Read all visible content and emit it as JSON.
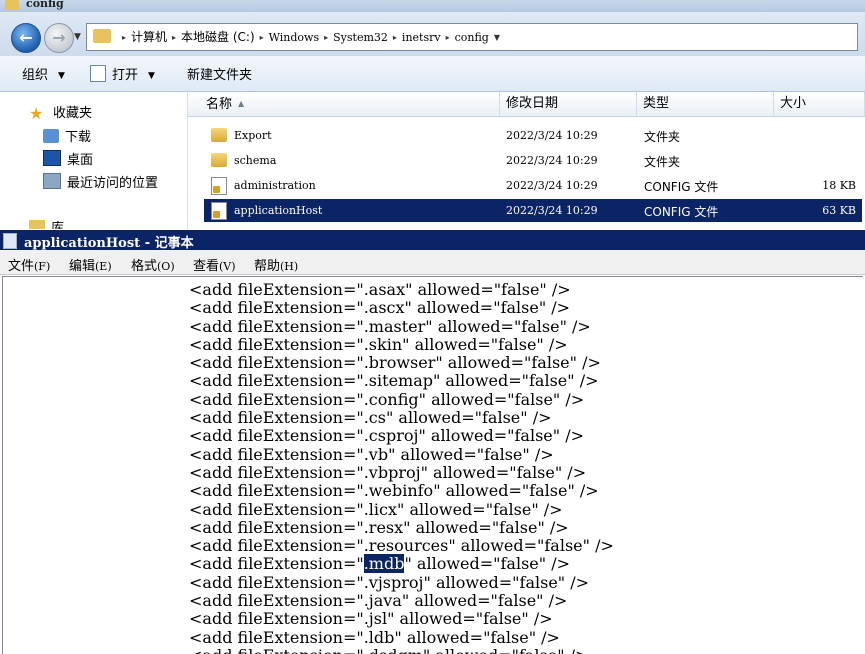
{
  "explorer": {
    "title": "config",
    "address": {
      "crumbs": [
        "计算机",
        "本地磁盘 (C:)",
        "Windows",
        "System32",
        "inetsrv",
        "config"
      ],
      "separator": "▸"
    },
    "toolbar": {
      "organize": "组织",
      "open": "打开",
      "new_folder": "新建文件夹"
    },
    "nav": {
      "favorites": "收藏夹",
      "downloads": "下载",
      "desktop": "桌面",
      "recent": "最近访问的位置",
      "libraries": "库"
    },
    "columns": {
      "name": "名称",
      "date": "修改日期",
      "type": "类型",
      "size": "大小"
    },
    "files": [
      {
        "name": "Export",
        "date": "2022/3/24 10:29",
        "type": "文件夹",
        "size": "",
        "icon": "folder-icon"
      },
      {
        "name": "schema",
        "date": "2022/3/24 10:29",
        "type": "文件夹",
        "size": "",
        "icon": "folder-icon"
      },
      {
        "name": "administration",
        "date": "2022/3/24 10:29",
        "type": "CONFIG 文件",
        "size": "18 KB",
        "icon": "config-file-icon"
      },
      {
        "name": "applicationHost",
        "date": "2022/3/24 10:29",
        "type": "CONFIG 文件",
        "size": "63 KB",
        "icon": "config-file-icon",
        "selected": true
      }
    ]
  },
  "notepad": {
    "title_file": "applicationHost",
    "title_app": " - 记事本",
    "menu": [
      {
        "label": "文件",
        "accel": "(F)"
      },
      {
        "label": "编辑",
        "accel": "(E)"
      },
      {
        "label": "格式",
        "accel": "(O)"
      },
      {
        "label": "查看",
        "accel": "(V)"
      },
      {
        "label": "帮助",
        "accel": "(H)"
      }
    ],
    "lines": [
      {
        "pre": "<add fileExtension=\"",
        "ext": ".asax",
        "post": "\" allowed=\"false\" />"
      },
      {
        "pre": "<add fileExtension=\"",
        "ext": ".ascx",
        "post": "\" allowed=\"false\" />"
      },
      {
        "pre": "<add fileExtension=\"",
        "ext": ".master",
        "post": "\" allowed=\"false\" />"
      },
      {
        "pre": "<add fileExtension=\"",
        "ext": ".skin",
        "post": "\" allowed=\"false\" />"
      },
      {
        "pre": "<add fileExtension=\"",
        "ext": ".browser",
        "post": "\" allowed=\"false\" />"
      },
      {
        "pre": "<add fileExtension=\"",
        "ext": ".sitemap",
        "post": "\" allowed=\"false\" />"
      },
      {
        "pre": "<add fileExtension=\"",
        "ext": ".config",
        "post": "\" allowed=\"false\" />"
      },
      {
        "pre": "<add fileExtension=\"",
        "ext": ".cs",
        "post": "\" allowed=\"false\" />"
      },
      {
        "pre": "<add fileExtension=\"",
        "ext": ".csproj",
        "post": "\" allowed=\"false\" />"
      },
      {
        "pre": "<add fileExtension=\"",
        "ext": ".vb",
        "post": "\" allowed=\"false\" />"
      },
      {
        "pre": "<add fileExtension=\"",
        "ext": ".vbproj",
        "post": "\" allowed=\"false\" />"
      },
      {
        "pre": "<add fileExtension=\"",
        "ext": ".webinfo",
        "post": "\" allowed=\"false\" />"
      },
      {
        "pre": "<add fileExtension=\"",
        "ext": ".licx",
        "post": "\" allowed=\"false\" />"
      },
      {
        "pre": "<add fileExtension=\"",
        "ext": ".resx",
        "post": "\" allowed=\"false\" />"
      },
      {
        "pre": "<add fileExtension=\"",
        "ext": ".resources",
        "post": "\" allowed=\"false\" />"
      },
      {
        "pre": "<add fileExtension=\"",
        "ext": ".mdb",
        "post": "\" allowed=\"false\" />",
        "highlight": true
      },
      {
        "pre": "<add fileExtension=\"",
        "ext": ".vjsproj",
        "post": "\" allowed=\"false\" />"
      },
      {
        "pre": "<add fileExtension=\"",
        "ext": ".java",
        "post": "\" allowed=\"false\" />"
      },
      {
        "pre": "<add fileExtension=\"",
        "ext": ".jsl",
        "post": "\" allowed=\"false\" />"
      },
      {
        "pre": "<add fileExtension=\"",
        "ext": ".ldb",
        "post": "\" allowed=\"false\" />"
      },
      {
        "pre": "<add fileExtension=\"",
        "ext": ".dsdgm",
        "post": "\" allowed=\"false\" />"
      }
    ]
  }
}
